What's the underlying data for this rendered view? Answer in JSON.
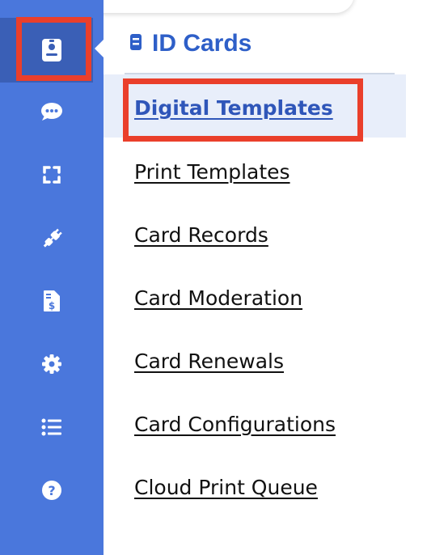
{
  "rail": {
    "background": "#4a77dc",
    "active_background": "#3a5fb6",
    "icons": [
      "id-card-icon",
      "chat-icon",
      "scan-frame-icon",
      "plug-icon",
      "invoice-icon",
      "gear-icon",
      "list-icon",
      "help-icon"
    ],
    "active_index": 0
  },
  "panel": {
    "title": "ID Cards",
    "title_icon": "id-badge-icon",
    "items": [
      {
        "label": "Digital Templates",
        "selected": true
      },
      {
        "label": "Print Templates"
      },
      {
        "label": "Card Records"
      },
      {
        "label": "Card Moderation"
      },
      {
        "label": "Card Renewals"
      },
      {
        "label": "Card Configurations"
      },
      {
        "label": "Cloud Print Queue"
      }
    ]
  },
  "colors": {
    "accent": "#2e5fc8",
    "selected_row": "#e8eefa",
    "highlight_box": "#ea3f2b"
  }
}
